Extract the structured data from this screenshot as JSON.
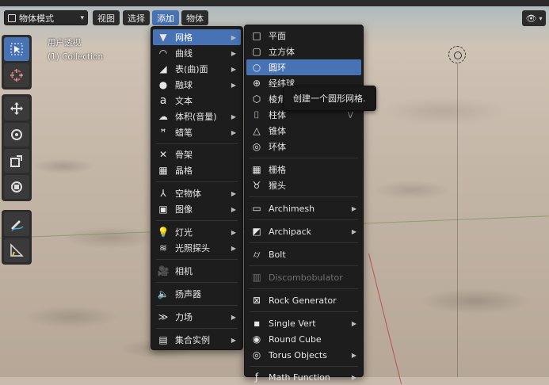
{
  "header": {
    "mode": "物体模式",
    "menus": [
      "视图",
      "选择",
      "添加",
      "物体"
    ]
  },
  "viewport": {
    "view_name": "用户透视",
    "collection": "(1) Collection"
  },
  "add_menu": {
    "items": [
      {
        "label": "网格",
        "icon": "mesh-icon",
        "submenu": true
      },
      {
        "label": "曲线",
        "icon": "curve-icon",
        "submenu": true
      },
      {
        "label": "表(曲)面",
        "icon": "surface-icon",
        "submenu": true
      },
      {
        "label": "融球",
        "icon": "metaball-icon",
        "submenu": true
      },
      {
        "label": "文本",
        "icon": "text-icon",
        "submenu": false
      },
      {
        "label": "体积(音量)",
        "icon": "volume-icon",
        "submenu": true
      },
      {
        "label": "蜡笔",
        "icon": "grease-pencil-icon",
        "submenu": true
      },
      {
        "label": "骨架",
        "icon": "armature-icon",
        "submenu": false
      },
      {
        "label": "晶格",
        "icon": "lattice-icon",
        "submenu": false
      },
      {
        "label": "空物体",
        "icon": "empty-icon",
        "submenu": true
      },
      {
        "label": "图像",
        "icon": "image-icon",
        "submenu": true
      },
      {
        "label": "灯光",
        "icon": "light-icon",
        "submenu": true
      },
      {
        "label": "光照探头",
        "icon": "light-probe-icon",
        "submenu": true
      },
      {
        "label": "相机",
        "icon": "camera-icon",
        "submenu": false
      },
      {
        "label": "扬声器",
        "icon": "speaker-icon",
        "submenu": false
      },
      {
        "label": "力场",
        "icon": "force-field-icon",
        "submenu": true
      },
      {
        "label": "集合实例",
        "icon": "collection-instance-icon",
        "submenu": true
      }
    ]
  },
  "mesh_menu": {
    "items": [
      {
        "label": "平面",
        "icon": "plane-icon",
        "submenu": false
      },
      {
        "label": "立方体",
        "icon": "cube-icon",
        "submenu": false
      },
      {
        "label": "圆环",
        "icon": "circle-icon",
        "submenu": false
      },
      {
        "label": "经纬球",
        "icon": "uv-sphere-icon",
        "submenu": false
      },
      {
        "label": "棱角球",
        "icon": "ico-sphere-icon",
        "submenu": false
      },
      {
        "label": "柱体",
        "icon": "cylinder-icon",
        "submenu": false
      },
      {
        "label": "锥体",
        "icon": "cone-icon",
        "submenu": false
      },
      {
        "label": "环体",
        "icon": "torus-icon",
        "submenu": false
      },
      {
        "label": "栅格",
        "icon": "grid-icon",
        "submenu": false
      },
      {
        "label": "猴头",
        "icon": "monkey-icon",
        "submenu": false
      },
      {
        "label": "Archimesh",
        "icon": "archimesh-icon",
        "submenu": true
      },
      {
        "label": "Archipack",
        "icon": "archipack-icon",
        "submenu": true
      },
      {
        "label": "Bolt",
        "icon": "bolt-icon",
        "submenu": false
      },
      {
        "label": "Discombobulator",
        "icon": "discombobulator-icon",
        "submenu": false,
        "disabled": true
      },
      {
        "label": "Rock Generator",
        "icon": "rock-icon",
        "submenu": false
      },
      {
        "label": "Single Vert",
        "icon": "vertex-icon",
        "submenu": true
      },
      {
        "label": "Round Cube",
        "icon": "round-cube-icon",
        "submenu": false
      },
      {
        "label": "Torus Objects",
        "icon": "torus-objects-icon",
        "submenu": true
      },
      {
        "label": "Math Function",
        "icon": "math-function-icon",
        "submenu": true
      }
    ],
    "highlighted": "圆环",
    "hidden_shortcut": "V"
  },
  "tooltip": {
    "text": "创建一个圆形网格."
  },
  "colors": {
    "accent": "#4772b3",
    "menu_bg": "#1d1d1d",
    "header_bg": "#2b2b2b"
  }
}
